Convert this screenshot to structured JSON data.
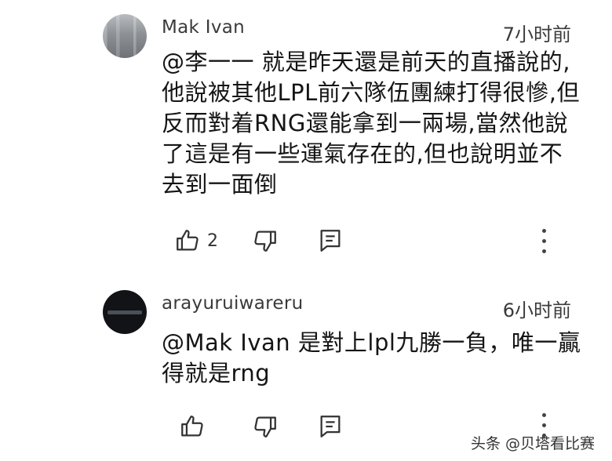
{
  "comments": [
    {
      "author": "Mak Ivan",
      "time": "7小时前",
      "text": "@李一一  就是昨天還是前天的直播說的,他說被其他LPL前六隊伍團練打得很慘,但反而對着RNG還能拿到一兩場,當然他說了這是有一些運氣存在的,但也說明並不去到一面倒",
      "likes": "2"
    },
    {
      "author": "arayuruiwareru",
      "time": "6小时前",
      "text": "@Mak Ivan  是對上lpl九勝一負，唯一贏得就是rng",
      "likes": ""
    }
  ],
  "icons": {
    "like": "thumbs-up-icon",
    "dislike": "thumbs-down-icon",
    "reply": "reply-icon",
    "more": "more-vertical-icon"
  },
  "watermark": "头条 @贝塔看比赛"
}
